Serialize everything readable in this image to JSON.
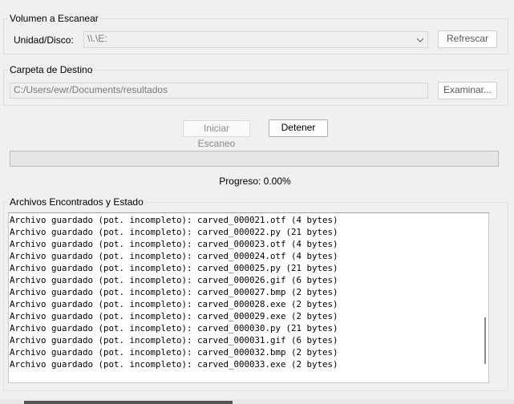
{
  "volume_group": {
    "title": "Volumen a Escanear",
    "drive_label": "Unidad/Disco:",
    "drive_value": "\\\\.\\E:",
    "refresh_label": "Refrescar"
  },
  "dest_group": {
    "title": "Carpeta de Destino",
    "path_value": "C:/Users/ewr/Documents/resultados",
    "browse_label": "Examinar..."
  },
  "actions": {
    "start_label": "Iniciar Escaneo",
    "stop_label": "Detener"
  },
  "progress": {
    "label": "Progreso: 0.00%",
    "fraction": 0.0
  },
  "files_group": {
    "title": "Archivos Encontrados y Estado",
    "lines": [
      "Archivo guardado (pot. incompleto): carved_000021.otf (4 bytes)",
      "Archivo guardado (pot. incompleto): carved_000022.py (21 bytes)",
      "Archivo guardado (pot. incompleto): carved_000023.otf (4 bytes)",
      "Archivo guardado (pot. incompleto): carved_000024.otf (4 bytes)",
      "Archivo guardado (pot. incompleto): carved_000025.py (21 bytes)",
      "Archivo guardado (pot. incompleto): carved_000026.gif (6 bytes)",
      "Archivo guardado (pot. incompleto): carved_000027.bmp (2 bytes)",
      "Archivo guardado (pot. incompleto): carved_000028.exe (2 bytes)",
      "Archivo guardado (pot. incompleto): carved_000029.exe (2 bytes)",
      "Archivo guardado (pot. incompleto): carved_000030.py (21 bytes)",
      "Archivo guardado (pot. incompleto): carved_000031.gif (6 bytes)",
      "Archivo guardado (pot. incompleto): carved_000032.bmp (2 bytes)",
      "Archivo guardado (pot. incompleto): carved_000033.exe (2 bytes)"
    ]
  },
  "icons": {
    "combo_arrow": "chevron-down-icon"
  }
}
